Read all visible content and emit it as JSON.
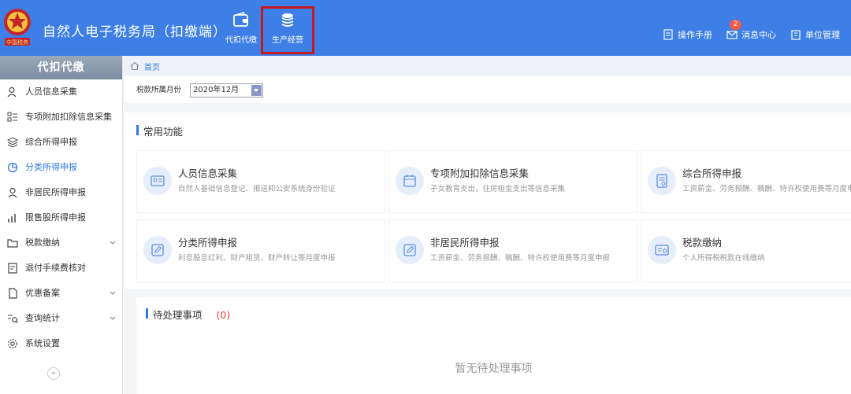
{
  "header": {
    "title": "自然人电子税务局（扣缴端）",
    "nav": [
      {
        "label": "代扣代缴",
        "icon": "wallet-icon"
      },
      {
        "label": "生产经营",
        "icon": "coins-icon"
      }
    ],
    "links": [
      {
        "label": "操作手册",
        "icon": "manual-icon"
      },
      {
        "label": "消息中心",
        "icon": "mail-icon",
        "badge": "2"
      },
      {
        "label": "单位管理",
        "icon": "building-icon"
      }
    ],
    "highlight_color": "#c9181e"
  },
  "sidebar": {
    "heading": "代扣代缴",
    "items": [
      {
        "label": "人员信息采集",
        "icon": "person-icon"
      },
      {
        "label": "专项附加扣除信息采集",
        "icon": "list-icon"
      },
      {
        "label": "综合所得申报",
        "icon": "layers-icon"
      },
      {
        "label": "分类所得申报",
        "icon": "pie-icon",
        "active": true
      },
      {
        "label": "非居民所得申报",
        "icon": "user-icon"
      },
      {
        "label": "限售股所得申报",
        "icon": "bar-chart-icon"
      },
      {
        "label": "税款缴纳",
        "icon": "folder-icon",
        "expandable": true
      },
      {
        "label": "退付手续费核对",
        "icon": "doc-icon"
      },
      {
        "label": "优惠备案",
        "icon": "file-icon",
        "expandable": true
      },
      {
        "label": "查询统计",
        "icon": "search-list-icon",
        "expandable": true
      },
      {
        "label": "系统设置",
        "icon": "gear-icon"
      }
    ],
    "collapse_label": "«"
  },
  "breadcrumb": {
    "home": "首页"
  },
  "filter": {
    "label": "税款所属月份",
    "value": "2020年12月"
  },
  "common": {
    "title": "常用功能",
    "cards": [
      {
        "title": "人员信息采集",
        "desc": "自然人基础信息登记、报送和公安系统身份验证",
        "icon": "id-card-icon"
      },
      {
        "title": "专项附加扣除信息采集",
        "desc": "子女教育支出，住房租金支出等信息采集",
        "icon": "calendar-icon"
      },
      {
        "title": "综合所得申报",
        "desc": "工资薪金、劳务报酬、稿酬、特许权使用费等月度申报",
        "icon": "report-icon"
      },
      {
        "title": "分类所得申报",
        "desc": "利息股息红利、财产租赁、财产转让等月度申报",
        "icon": "edit-icon"
      },
      {
        "title": "非居民所得申报",
        "desc": "工资薪金、劳务报酬、稿酬、特许权使用费等月度申报",
        "icon": "edit-icon"
      },
      {
        "title": "税款缴纳",
        "desc": "个人所得税税款在线缴纳",
        "icon": "tax-pay-icon"
      }
    ]
  },
  "pending": {
    "title": "待处理事项",
    "count": "(0)",
    "empty": "暂无待处理事项"
  }
}
